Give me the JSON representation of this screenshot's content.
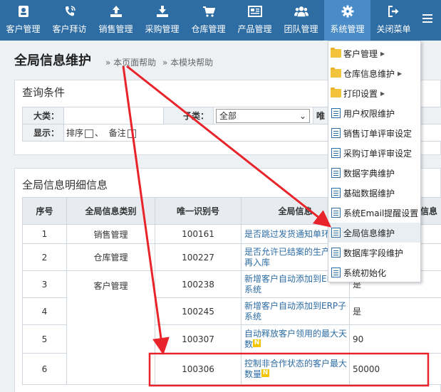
{
  "nav": {
    "items": [
      {
        "label": "客户管理",
        "icon": "contact-card-icon"
      },
      {
        "label": "客户拜访",
        "icon": "phone-icon"
      },
      {
        "label": "销售管理",
        "icon": "upload-icon"
      },
      {
        "label": "采购管理",
        "icon": "download-icon"
      },
      {
        "label": "仓库管理",
        "icon": "cart-icon"
      },
      {
        "label": "产品管理",
        "icon": "newspaper-icon"
      },
      {
        "label": "团队管理",
        "icon": "team-icon"
      },
      {
        "label": "系统管理",
        "icon": "gear-icon"
      },
      {
        "label": "关闭菜单",
        "icon": "exit-icon"
      }
    ],
    "colors": {
      "bar": "#2e6da4",
      "active": "#4a8cc7"
    }
  },
  "page": {
    "title": "全局信息维护",
    "help_page": "» 本页面帮助",
    "help_module": "» 本模块帮助"
  },
  "query": {
    "title": "查询条件",
    "category_label": "大类：",
    "subcategory_label": "子类：",
    "subcategory_value": "全部",
    "unique_label_partial": "唯",
    "display_label": "显示：",
    "sort_label": "排序",
    "separator": "、",
    "remark_label": "备注"
  },
  "detail": {
    "title": "全局信息明细信息",
    "columns": [
      "序号",
      "全局信息类别",
      "唯一识别号",
      "全局信息标题",
      "全局信息值"
    ],
    "col4_partial": "全局信息",
    "col5_partial": "信息",
    "rows": [
      {
        "seq": "1",
        "category": "销售管理",
        "id": "100161",
        "title": "是否跳过发货通知单环",
        "value": ""
      },
      {
        "seq": "2",
        "category": "仓库管理",
        "id": "100227",
        "title": "是否允许已结案的生产",
        "title2": "再入库",
        "value": ""
      },
      {
        "seq": "3",
        "category": "客户管理",
        "id": "100238",
        "title": "新增客户自动添加到ER",
        "title2": "系统",
        "value": "是"
      },
      {
        "seq": "4",
        "category": "",
        "id": "100245",
        "title": "新增客户自动添加到ERP子",
        "title2": "系统",
        "value": "是"
      },
      {
        "seq": "5",
        "category": "",
        "id": "100307",
        "title": "自动释放客户领用的最大天",
        "title2": "数",
        "value": "90"
      },
      {
        "seq": "6",
        "category": "",
        "id": "100306",
        "title": "控制非合作状态的客户最大",
        "title2": "数量",
        "value": "50000"
      }
    ]
  },
  "dropdown": {
    "items": [
      {
        "label": "客户管理",
        "kind": "folder",
        "submenu": true
      },
      {
        "label": "仓库信息维护",
        "kind": "folder",
        "submenu": true
      },
      {
        "label": "打印设置",
        "kind": "folder",
        "submenu": true
      },
      {
        "label": "用户权限维护",
        "kind": "doc"
      },
      {
        "label": "销售订单评审设定",
        "kind": "doc"
      },
      {
        "label": "采购订单评审设定",
        "kind": "doc"
      },
      {
        "label": "数据字典维护",
        "kind": "doc"
      },
      {
        "label": "基础数据维护",
        "kind": "doc"
      },
      {
        "label": "系统Email提醒设置",
        "kind": "doc"
      },
      {
        "label": "全局信息维护",
        "kind": "doc",
        "highlighted": true
      },
      {
        "label": "数据库字段维护",
        "kind": "doc"
      },
      {
        "label": "系统初始化",
        "kind": "doc"
      }
    ]
  },
  "new_badge": "N",
  "annotation_color": "#e8232a"
}
